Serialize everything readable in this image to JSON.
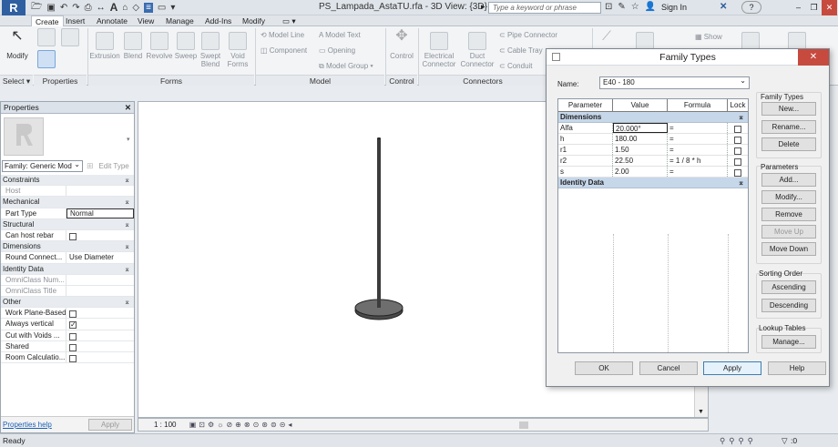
{
  "titlebar": {
    "app_logo": "R",
    "document_title": "PS_Lampada_AstaTU.rfa - 3D View: {3D}",
    "search_placeholder": "Type a keyword or phrase",
    "sign_in": "Sign In",
    "help": "?"
  },
  "tabs": [
    "Create",
    "Insert",
    "Annotate",
    "View",
    "Manage",
    "Add-Ins",
    "Modify",
    "▭ ▾"
  ],
  "ribbon": {
    "modify": "Modify",
    "select": "Select ▾",
    "properties_group": "Properties",
    "forms": {
      "label": "Forms",
      "buttons": [
        "Extrusion",
        "Blend",
        "Revolve",
        "Sweep",
        "Swept\nBlend",
        "Void\nForms"
      ]
    },
    "model": {
      "label": "Model",
      "items": [
        "Model  Line",
        "Component",
        "Model  Text",
        "Opening",
        "Model  Group ▾"
      ]
    },
    "control": {
      "label": "Control",
      "button": "Control"
    },
    "connectors": {
      "label": "Connectors",
      "buttons": [
        "Electrical\nConnector",
        "Duct\nConnector"
      ],
      "items": [
        "Pipe  Connector",
        "Cable Tray",
        "Conduit"
      ]
    },
    "show": "Show"
  },
  "properties": {
    "title": "Properties",
    "close": "✕",
    "family_label": "Family: Generic Mod",
    "edit_type": "Edit Type",
    "help_link": "Properties help",
    "apply": "Apply",
    "sections": [
      {
        "name": "Constraints",
        "rows": [
          {
            "name": "Host",
            "value": "",
            "gray": true
          }
        ]
      },
      {
        "name": "Mechanical",
        "rows": [
          {
            "name": "Part Type",
            "value": "Normal",
            "box": true
          }
        ]
      },
      {
        "name": "Structural",
        "rows": [
          {
            "name": "Can host rebar",
            "check": false
          }
        ]
      },
      {
        "name": "Dimensions",
        "rows": [
          {
            "name": "Round Connect...",
            "value": "Use Diameter"
          }
        ]
      },
      {
        "name": "Identity Data",
        "rows": [
          {
            "name": "OmniClass Num...",
            "value": "",
            "gray": true
          },
          {
            "name": "OmniClass Title",
            "value": "",
            "gray": true
          }
        ]
      },
      {
        "name": "Other",
        "rows": [
          {
            "name": "Work Plane-Based",
            "check": false
          },
          {
            "name": "Always vertical",
            "check": true
          },
          {
            "name": "Cut with Voids ...",
            "check": false
          },
          {
            "name": "Shared",
            "check": false
          },
          {
            "name": "Room Calculatio...",
            "check": false
          }
        ]
      }
    ]
  },
  "viewbar": {
    "scale": "1 : 100"
  },
  "statusbar": {
    "text": "Ready",
    "filter_count": ":0"
  },
  "dialog": {
    "title": "Family Types",
    "close": "✕",
    "name_label": "Name:",
    "name_value": "E40 - 180",
    "columns": [
      "Parameter",
      "Value",
      "Formula",
      "Lock"
    ],
    "groups": [
      {
        "name": "Dimensions",
        "toggle": "⌅",
        "rows": [
          {
            "param": "Alfa",
            "value": "20.000°",
            "formula": "=",
            "selected": true
          },
          {
            "param": "h",
            "value": "180.00",
            "formula": "="
          },
          {
            "param": "r1",
            "value": "1.50",
            "formula": "="
          },
          {
            "param": "r2",
            "value": "22.50",
            "formula": "= 1 / 8 * h"
          },
          {
            "param": "s",
            "value": "2.00",
            "formula": "="
          }
        ]
      },
      {
        "name": "Identity Data",
        "toggle": "⌅",
        "rows": []
      }
    ],
    "family_types": {
      "label": "Family Types",
      "buttons": [
        "New...",
        "Rename...",
        "Delete"
      ]
    },
    "parameters": {
      "label": "Parameters",
      "buttons": [
        "Add...",
        "Modify...",
        "Remove",
        "Move Up",
        "Move Down"
      ]
    },
    "sorting": {
      "label": "Sorting Order",
      "buttons": [
        "Ascending",
        "Descending"
      ]
    },
    "lookup": {
      "label": "Lookup Tables",
      "button": "Manage..."
    },
    "footer": [
      "OK",
      "Cancel",
      "Apply",
      "Help"
    ]
  }
}
